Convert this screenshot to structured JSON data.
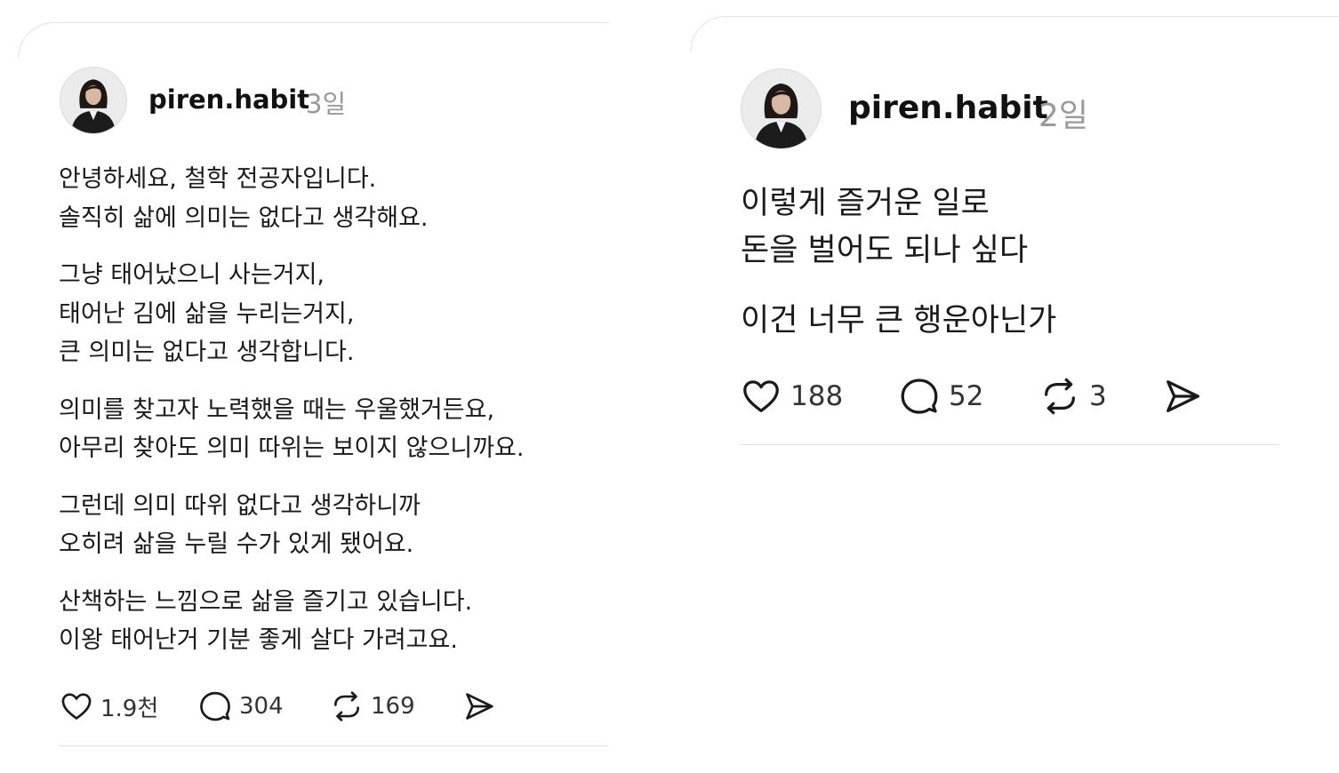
{
  "posts": [
    {
      "username": "piren.habit",
      "time": "3일",
      "paragraphs": [
        [
          "안녕하세요, 철학 전공자입니다.",
          "솔직히 삶에 의미는 없다고 생각해요."
        ],
        [
          "그냥 태어났으니 사는거지,",
          "태어난 김에 삶을 누리는거지,",
          "큰 의미는 없다고 생각합니다."
        ],
        [
          "의미를 찾고자 노력했을 때는 우울했거든요,",
          "아무리 찾아도 의미 따위는 보이지 않으니까요."
        ],
        [
          "그런데 의미 따위 없다고 생각하니까",
          "오히려 삶을 누릴 수가 있게 됐어요."
        ],
        [
          "산책하는 느낌으로 삶을 즐기고 있습니다.",
          "이왕 태어난거 기분 좋게 살다 가려고요."
        ]
      ],
      "likes": "1.9천",
      "replies": "304",
      "reposts": "169"
    },
    {
      "username": "piren.habit",
      "time": "2일",
      "paragraphs": [
        [
          "이렇게 즐거운 일로",
          "돈을 벌어도 되나 싶다"
        ],
        [
          "이건 너무 큰 행운아닌가"
        ]
      ],
      "likes": "188",
      "replies": "52",
      "reposts": "3"
    }
  ],
  "icons": {
    "avatar": "profile-photo",
    "like": "heart-icon",
    "reply": "speech-bubble-icon",
    "repost": "repost-icon",
    "share": "send-icon"
  },
  "colors": {
    "background": "#ffffff",
    "text": "#111111",
    "muted": "#9a9a9a",
    "divider": "#e1e1e1"
  }
}
